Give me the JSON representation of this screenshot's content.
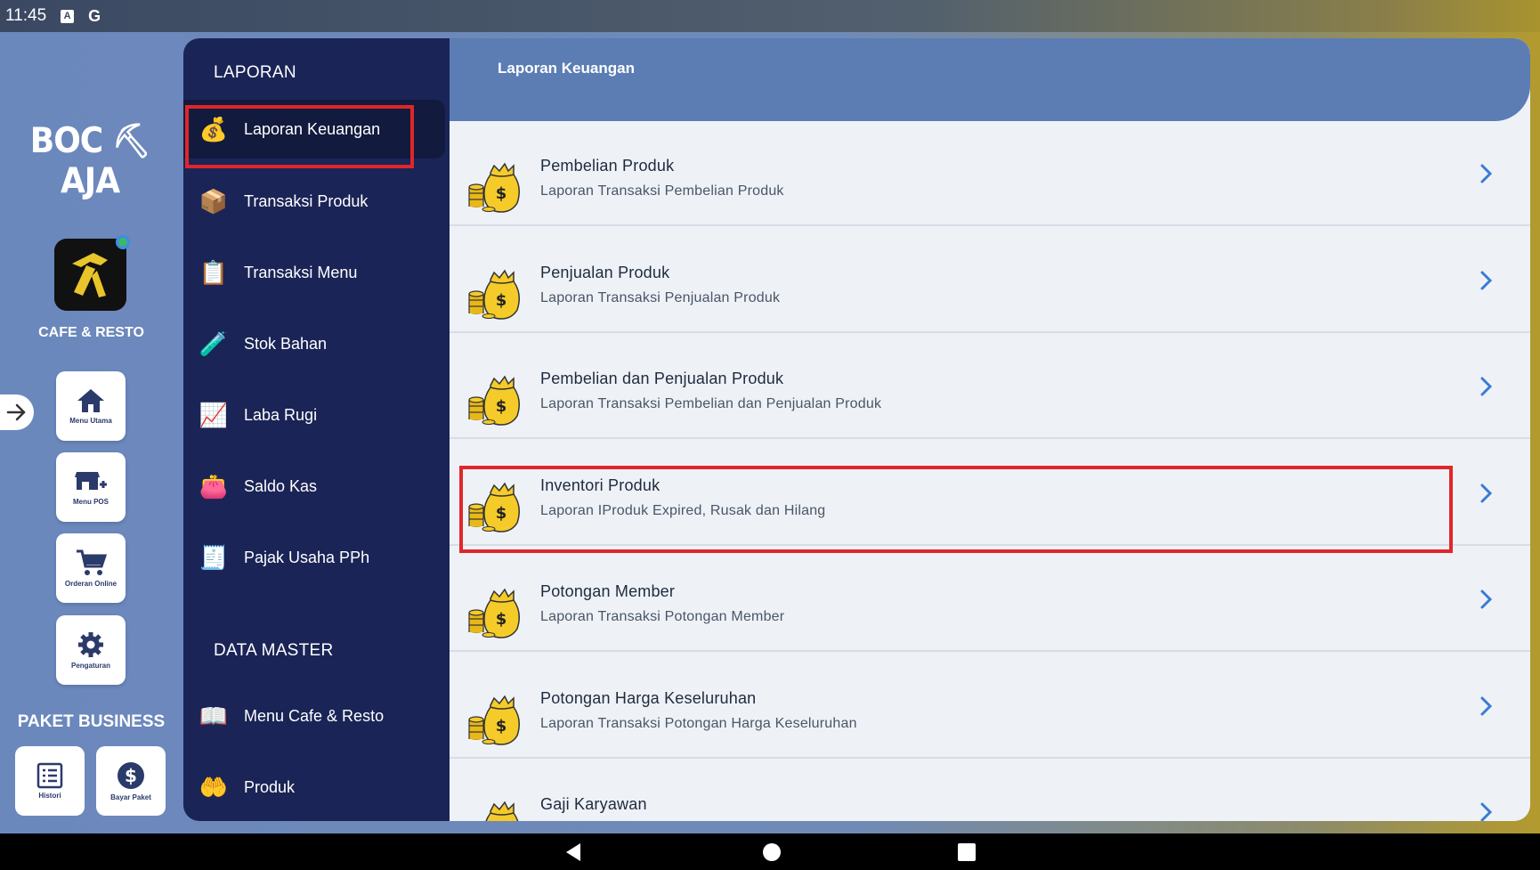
{
  "status_bar": {
    "time": "11:45",
    "icon_a": "A",
    "icon_g": "G"
  },
  "rail": {
    "logo": "BOC AJA",
    "brand": "CAFE & RESTO",
    "buttons": [
      {
        "label": "Menu Utama",
        "icon": "home-icon"
      },
      {
        "label": "Menu POS",
        "icon": "pos-icon"
      },
      {
        "label": "Orderan Online",
        "icon": "cart-icon"
      },
      {
        "label": "Pengaturan",
        "icon": "gear-icon"
      }
    ],
    "paket_label": "PAKET BUSINESS",
    "paket_buttons": [
      {
        "label": "Histori",
        "icon": "list-icon"
      },
      {
        "label": "Bayar Paket",
        "icon": "dollar-icon"
      }
    ]
  },
  "nav": {
    "section_laporan": "LAPORAN",
    "laporan_items": [
      {
        "label": "Laporan Keuangan",
        "icon": "money-bag-icon"
      },
      {
        "label": "Transaksi Produk",
        "icon": "box-icon"
      },
      {
        "label": "Transaksi Menu",
        "icon": "menu-board-icon"
      },
      {
        "label": "Stok Bahan",
        "icon": "stock-icon"
      },
      {
        "label": "Laba Rugi",
        "icon": "profit-icon"
      },
      {
        "label": "Saldo Kas",
        "icon": "wallet-icon"
      },
      {
        "label": "Pajak Usaha PPh",
        "icon": "tax-icon"
      }
    ],
    "section_master": "DATA MASTER",
    "master_items": [
      {
        "label": "Menu Cafe & Resto",
        "icon": "menu-book-icon"
      },
      {
        "label": "Produk",
        "icon": "product-icon"
      }
    ]
  },
  "main": {
    "title": "Laporan Keuangan",
    "rows": [
      {
        "title": "Pembelian Produk",
        "subtitle": "Laporan Transaksi Pembelian Produk"
      },
      {
        "title": "Penjualan Produk",
        "subtitle": "Laporan Transaksi Penjualan Produk"
      },
      {
        "title": "Pembelian dan Penjualan Produk",
        "subtitle": "Laporan Transaksi Pembelian dan Penjualan Produk"
      },
      {
        "title": "Inventori Produk",
        "subtitle": "Laporan IProduk Expired, Rusak dan Hilang"
      },
      {
        "title": "Potongan Member",
        "subtitle": "Laporan Transaksi Potongan Member"
      },
      {
        "title": "Potongan Harga Keseluruhan",
        "subtitle": "Laporan Transaksi Potongan Harga Keseluruhan"
      },
      {
        "title": "Gaji Karyawan",
        "subtitle": ""
      }
    ]
  },
  "colors": {
    "nav_bg": "#1a2456",
    "header_bg": "#5b7db4",
    "highlight": "#e0262b",
    "chevron": "#3a7bd5"
  }
}
